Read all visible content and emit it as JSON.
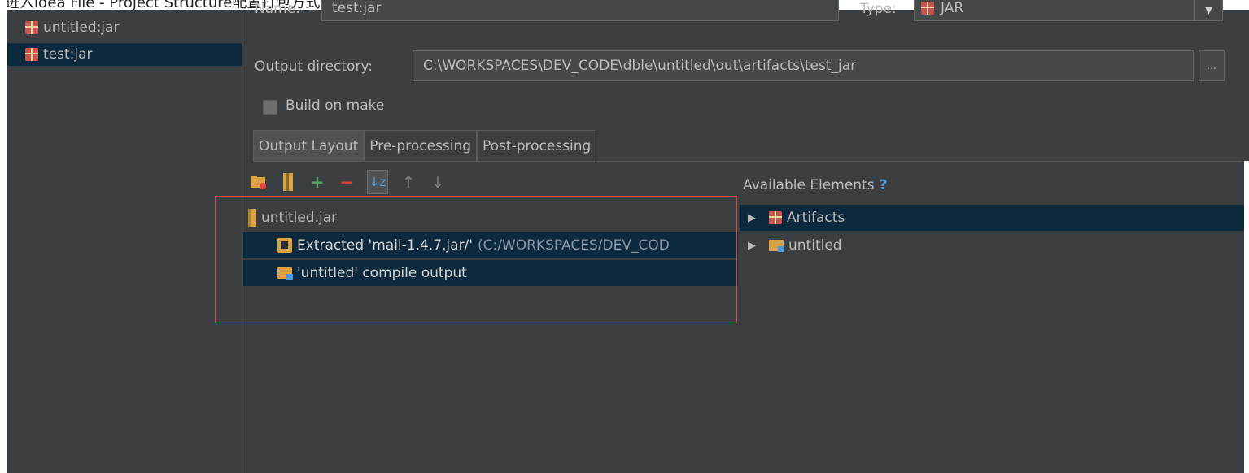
{
  "top_text": "进入idea File - Project Structure配置打包方式",
  "sidebar": {
    "items": [
      {
        "label": "untitled:jar",
        "selected": false
      },
      {
        "label": "test:jar",
        "selected": true
      }
    ]
  },
  "form": {
    "name_label": "Name:",
    "name_value": "test:jar",
    "type_label": "Type:",
    "type_value": "JAR",
    "output_dir_label": "Output directory:",
    "output_dir_value": "C:\\WORKSPACES\\DEV_CODE\\dble\\untitled\\out\\artifacts\\test_jar",
    "browse_label": "...",
    "build_on_make_label": "Build on make"
  },
  "tabs": [
    {
      "label": "Output Layout",
      "active": true
    },
    {
      "label": "Pre-processing",
      "active": false
    },
    {
      "label": "Post-processing",
      "active": false
    }
  ],
  "toolbar_icons": [
    "new-folder-icon",
    "archive-icon",
    "add-icon",
    "remove-icon",
    "sort-icon",
    "move-up-icon",
    "move-down-icon"
  ],
  "output_tree": {
    "root": "untitled.jar",
    "children": [
      {
        "label": "Extracted 'mail-1.4.7.jar/'",
        "detail": "(C:/WORKSPACES/DEV_COD",
        "icon": "extracted-icon"
      },
      {
        "label": "'untitled' compile output",
        "detail": "",
        "icon": "module-folder-icon"
      }
    ]
  },
  "available": {
    "title": "Available Elements",
    "help": "?",
    "items": [
      {
        "label": "Artifacts",
        "icon": "artifact-icon"
      },
      {
        "label": "untitled",
        "icon": "module-folder-icon"
      }
    ]
  },
  "colors": {
    "background": "#3c3f41",
    "selection": "#0d293e",
    "highlight_box": "#e0443a",
    "text": "#bbbbbb"
  }
}
